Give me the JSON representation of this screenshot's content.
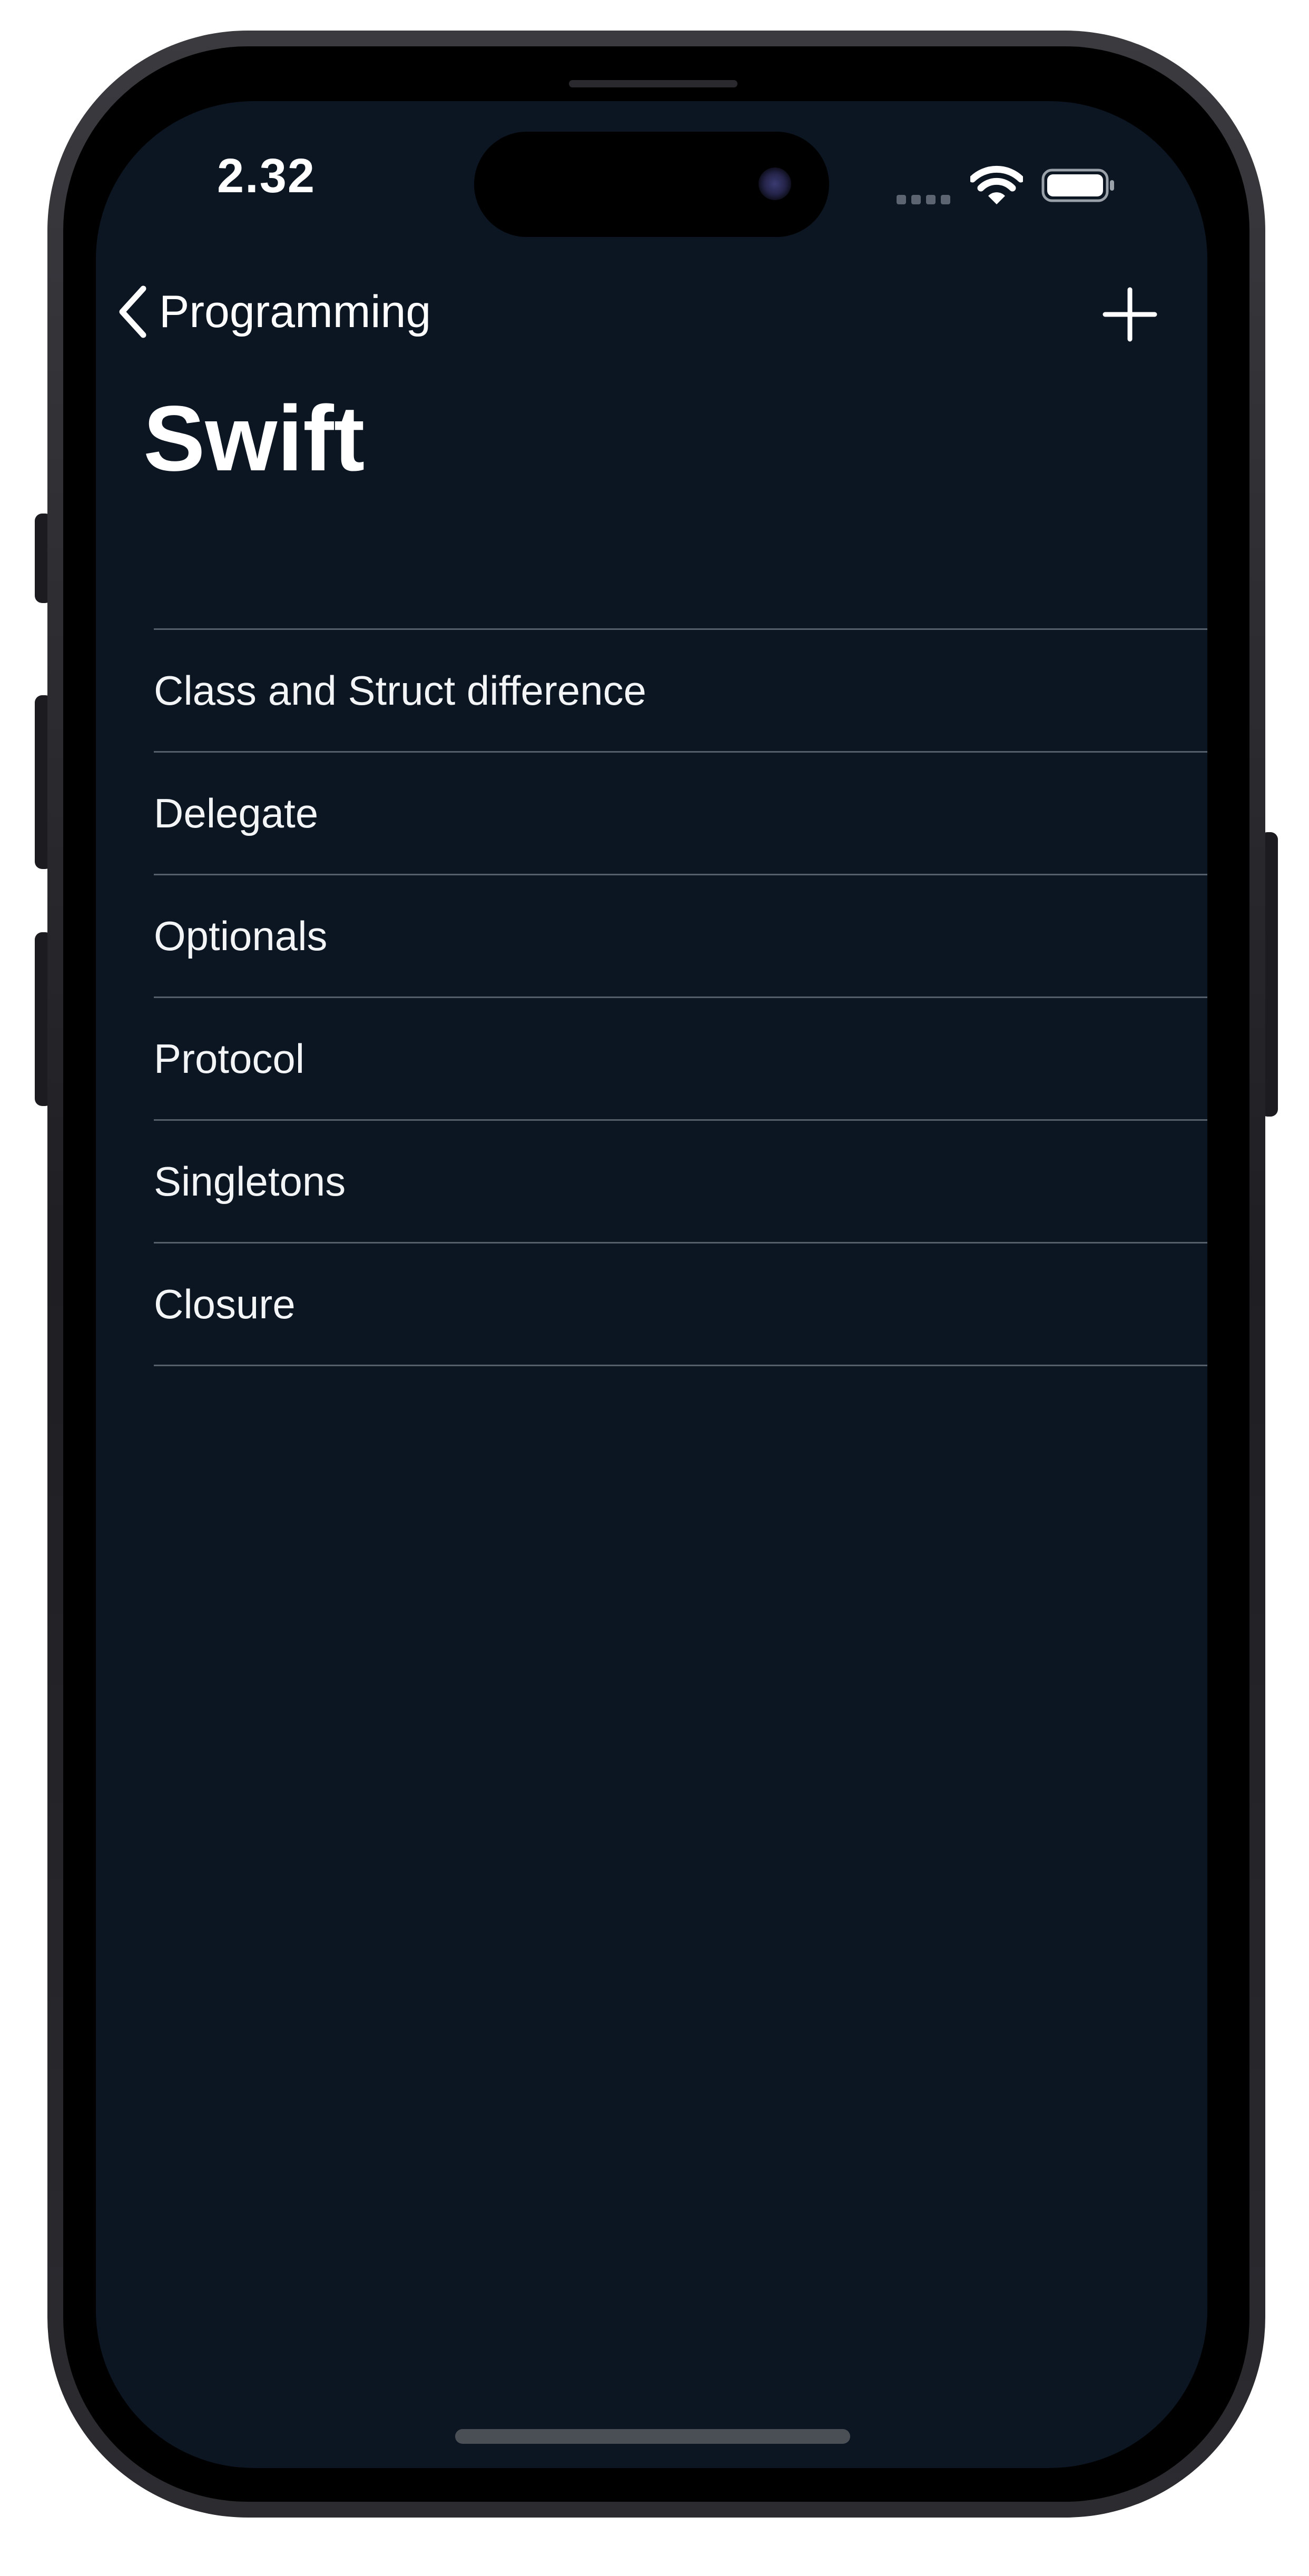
{
  "status_bar": {
    "time": "2.32"
  },
  "nav": {
    "back_label": "Programming",
    "title": "Swift"
  },
  "topics": [
    {
      "label": "Class and Struct difference"
    },
    {
      "label": "Delegate"
    },
    {
      "label": "Optionals"
    },
    {
      "label": "Protocol"
    },
    {
      "label": "Singletons"
    },
    {
      "label": "Closure"
    }
  ],
  "icons": {
    "back": "chevron-left-icon",
    "add": "plus-icon",
    "signal": "cellular-signal-icon",
    "wifi": "wifi-icon",
    "battery": "battery-icon"
  },
  "colors": {
    "background": "#0c1622",
    "text": "#ffffff",
    "separator": "#56606b"
  }
}
